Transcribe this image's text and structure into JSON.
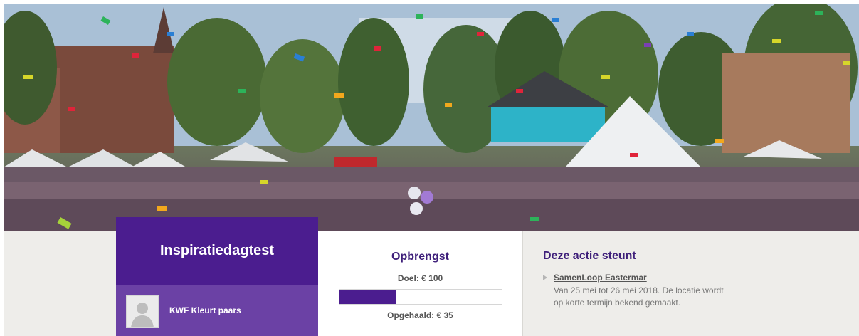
{
  "campaign": {
    "title": "Inspiratiedagtest",
    "owner": "KWF Kleurt paars",
    "avatar_icon": "default-user-avatar-icon"
  },
  "yield": {
    "title": "Opbrengst",
    "goal_label": "Doel: € 100",
    "raised_label": "Opgehaald: € 35",
    "progress_fraction": 0.35,
    "bar_color": "#4b1d8f"
  },
  "supports": {
    "title": "Deze actie steunt",
    "event_name": "SamenLoop Eastermar",
    "event_description": "Van 25 mei tot 26 mei 2018. De locatie wordt op korte termijn bekend gemaakt."
  },
  "colors": {
    "brand_purple": "#4b1d8f",
    "brand_purple_light": "#6b41a5",
    "heading_purple": "#3e1f7a",
    "panel_bg": "#eeedea"
  }
}
